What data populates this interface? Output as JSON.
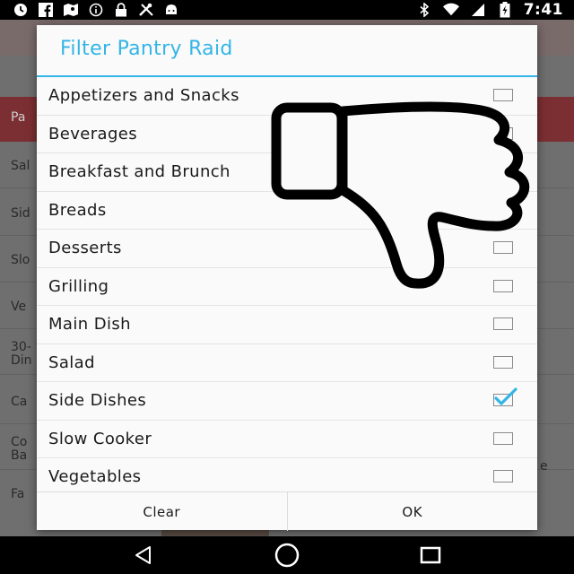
{
  "status_bar": {
    "time": "7:41",
    "left_icons": [
      "clock-icon",
      "facebook-icon",
      "maps-icon",
      "info-icon",
      "lock-icon",
      "tools-icon",
      "android-icon"
    ],
    "right_icons": [
      "bluetooth-icon",
      "wifi-icon",
      "signal-icon",
      "battery-icon"
    ]
  },
  "background": {
    "items": [
      "Pa",
      "Sal",
      "Sid",
      "Slo",
      "Ve",
      "30-",
      "Din",
      "Ca",
      "Co",
      "Ba",
      "Fa"
    ],
    "right_fragment": "e"
  },
  "dialog": {
    "title": "Filter Pantry Raid",
    "items": [
      {
        "label": "Appetizers and Snacks",
        "checked": false
      },
      {
        "label": "Beverages",
        "checked": false
      },
      {
        "label": "Breakfast and Brunch",
        "checked": false
      },
      {
        "label": "Breads",
        "checked": false
      },
      {
        "label": "Desserts",
        "checked": false
      },
      {
        "label": "Grilling",
        "checked": false
      },
      {
        "label": "Main Dish",
        "checked": false
      },
      {
        "label": "Salad",
        "checked": false
      },
      {
        "label": "Side Dishes",
        "checked": true
      },
      {
        "label": "Slow Cooker",
        "checked": false
      },
      {
        "label": "Vegetables",
        "checked": false
      }
    ],
    "clear_label": "Clear",
    "ok_label": "OK"
  },
  "overlay": {
    "icon": "thumbs-down-icon"
  },
  "nav_bar": {
    "icons": [
      "back-icon",
      "home-icon",
      "recents-icon"
    ]
  },
  "colors": {
    "accent": "#33b5e5",
    "check": "#33b5e5"
  }
}
